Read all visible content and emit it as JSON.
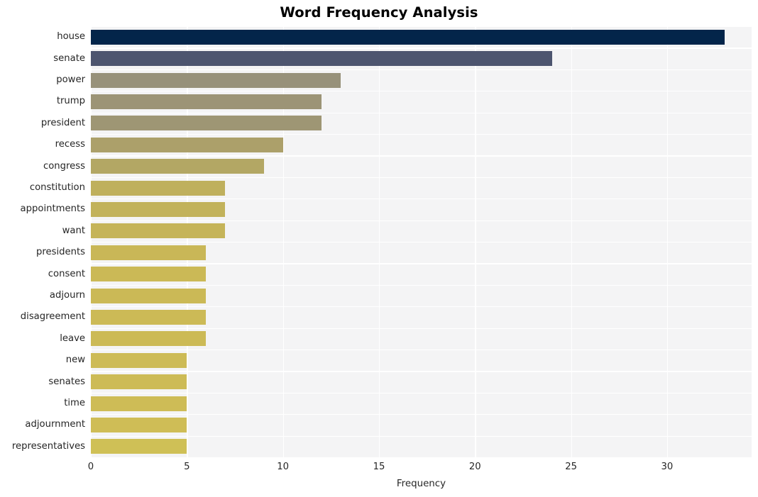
{
  "chart_data": {
    "type": "bar",
    "orientation": "horizontal",
    "title": "Word Frequency Analysis",
    "xlabel": "Frequency",
    "ylabel": "",
    "xlim": [
      0,
      34.4
    ],
    "xticks": [
      0,
      5,
      10,
      15,
      20,
      25,
      30
    ],
    "xticklabels": [
      "0",
      "5",
      "10",
      "15",
      "20",
      "25",
      "30"
    ],
    "grid": true,
    "legend": null,
    "categories": [
      "house",
      "senate",
      "power",
      "trump",
      "president",
      "recess",
      "congress",
      "constitution",
      "appointments",
      "want",
      "presidents",
      "consent",
      "adjourn",
      "disagreement",
      "leave",
      "new",
      "senates",
      "time",
      "adjournment",
      "representatives"
    ],
    "values": [
      33,
      24,
      13,
      12,
      12,
      10,
      9,
      7,
      7,
      7,
      6,
      6,
      6,
      6,
      6,
      5,
      5,
      5,
      5,
      5
    ],
    "bar_colors": [
      "#03254a",
      "#4d556f",
      "#97917a",
      "#9c9476",
      "#9e9674",
      "#aca06a",
      "#b3a764",
      "#bfb05d",
      "#c2b25b",
      "#c5b459",
      "#c9b757",
      "#cbb956",
      "#cbb956",
      "#ccba56",
      "#ccba56",
      "#cdbb56",
      "#cdbb56",
      "#cebc56",
      "#cfbd56",
      "#cfc056"
    ]
  },
  "style": {
    "plot_background": "#f4f4f5",
    "figure_background": "#ffffff",
    "grid_color": "#ffffff",
    "text_color": "#262626"
  }
}
